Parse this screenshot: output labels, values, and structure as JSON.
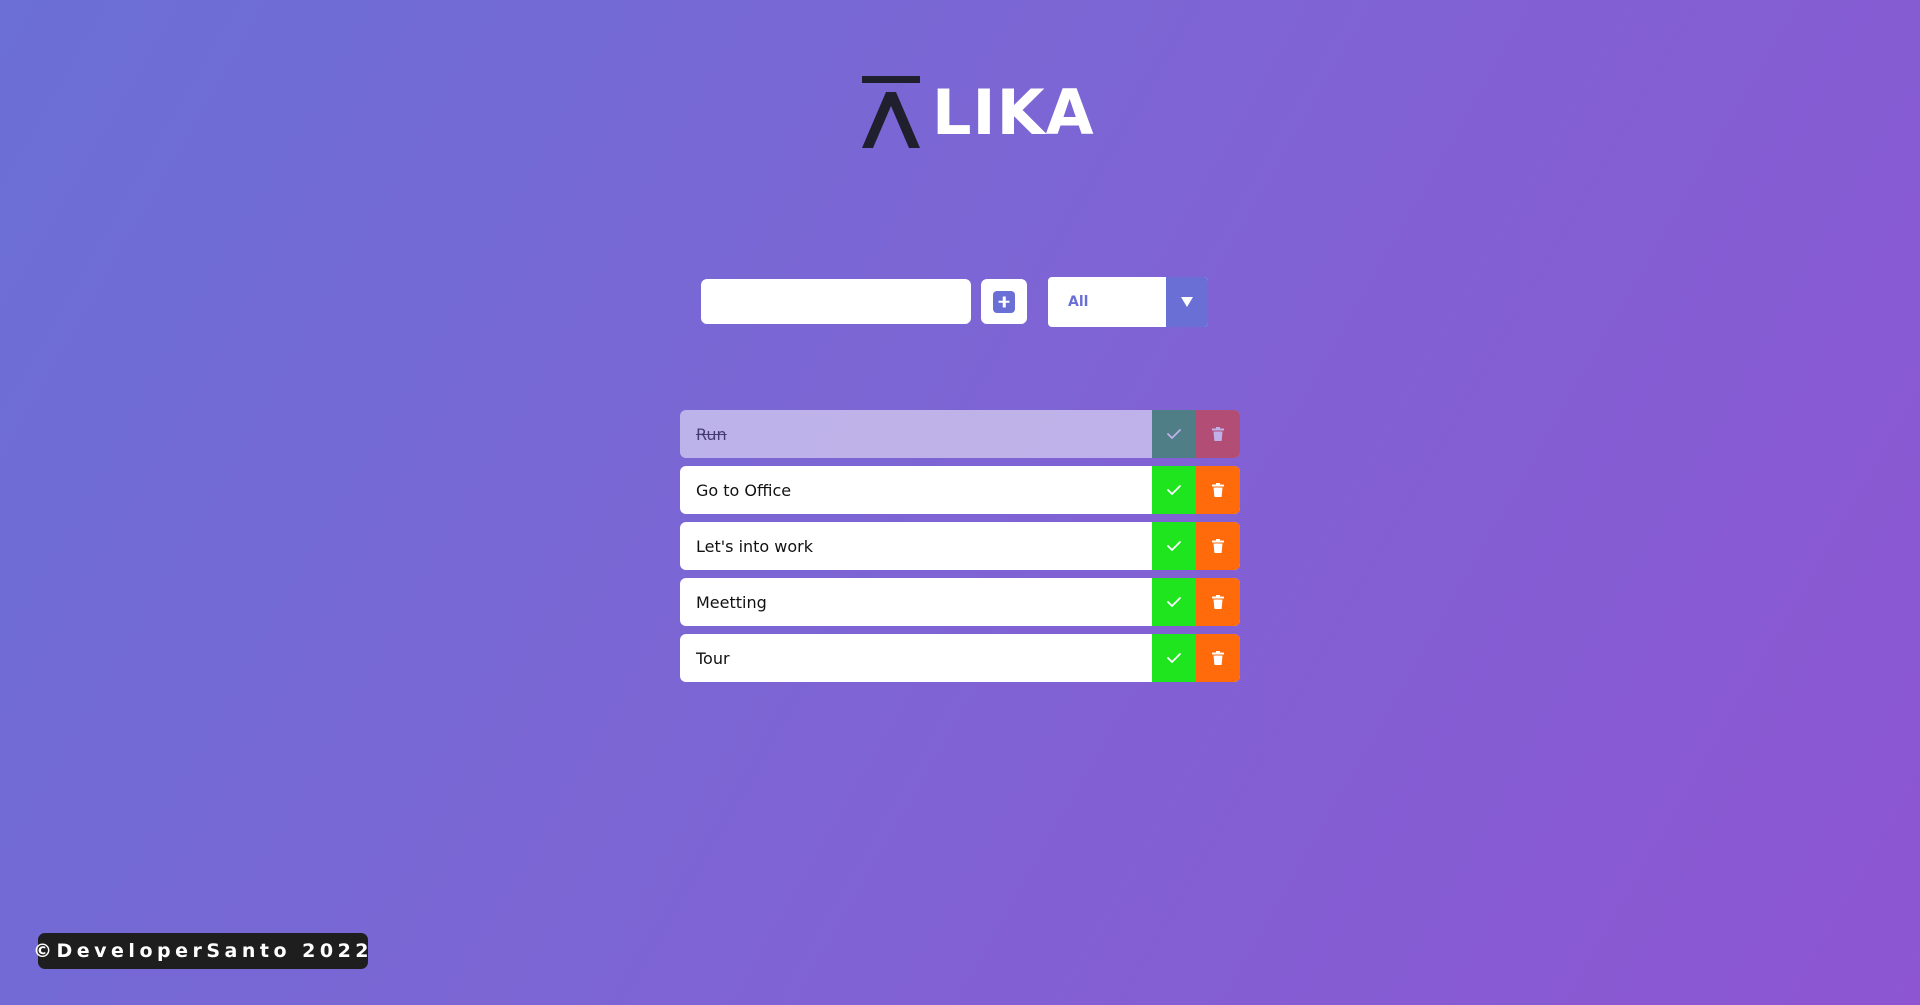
{
  "brand": {
    "name": "LIKA",
    "mark_icon": "a-bar-logo-icon",
    "mark_color": "#1f1f2e"
  },
  "form": {
    "input_value": "",
    "input_placeholder": "",
    "add_icon": "plus-square-icon",
    "filter_selected": "All",
    "filter_arrow_icon": "triangle-down-icon"
  },
  "todos": [
    {
      "text": "Run",
      "completed": true
    },
    {
      "text": "Go to Office",
      "completed": false
    },
    {
      "text": "Let's into work",
      "completed": false
    },
    {
      "text": "Meetting",
      "completed": false
    },
    {
      "text": "Tour",
      "completed": false
    }
  ],
  "footer": {
    "text": "©DeveloperSanto 2022"
  },
  "colors": {
    "accent": "#6a6fd6",
    "complete": "#1ee51e",
    "trash": "#ff6a0a",
    "footer_bg": "#1e1e1e"
  }
}
